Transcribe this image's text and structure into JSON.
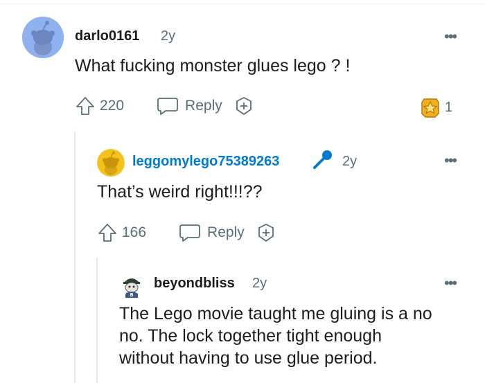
{
  "comments": [
    {
      "username": "darlo0161",
      "age": "2y",
      "body": "What fucking monster glues lego ? !",
      "upvotes": "220",
      "reply_label": "Reply",
      "award_count": "1",
      "more_label": "•••"
    },
    {
      "username": "leggomylego75389263",
      "age": "2y",
      "body": "That’s weird right!!!??",
      "upvotes": "166",
      "reply_label": "Reply",
      "more_label": "•••",
      "username_color": "#0079d3"
    },
    {
      "username": "beyondbliss",
      "age": "2y",
      "body_lines": [
        "The Lego movie taught me gluing is a no",
        "no. The lock together tight enough",
        "without having to use glue period."
      ],
      "more_label": "•••"
    }
  ],
  "colors": {
    "avatar_blue": "#8fb1f0",
    "avatar_yellow": "#f4c21a",
    "meta_gray": "#576f76",
    "link_blue": "#0079d3",
    "award_gold": "#f2b01e"
  }
}
